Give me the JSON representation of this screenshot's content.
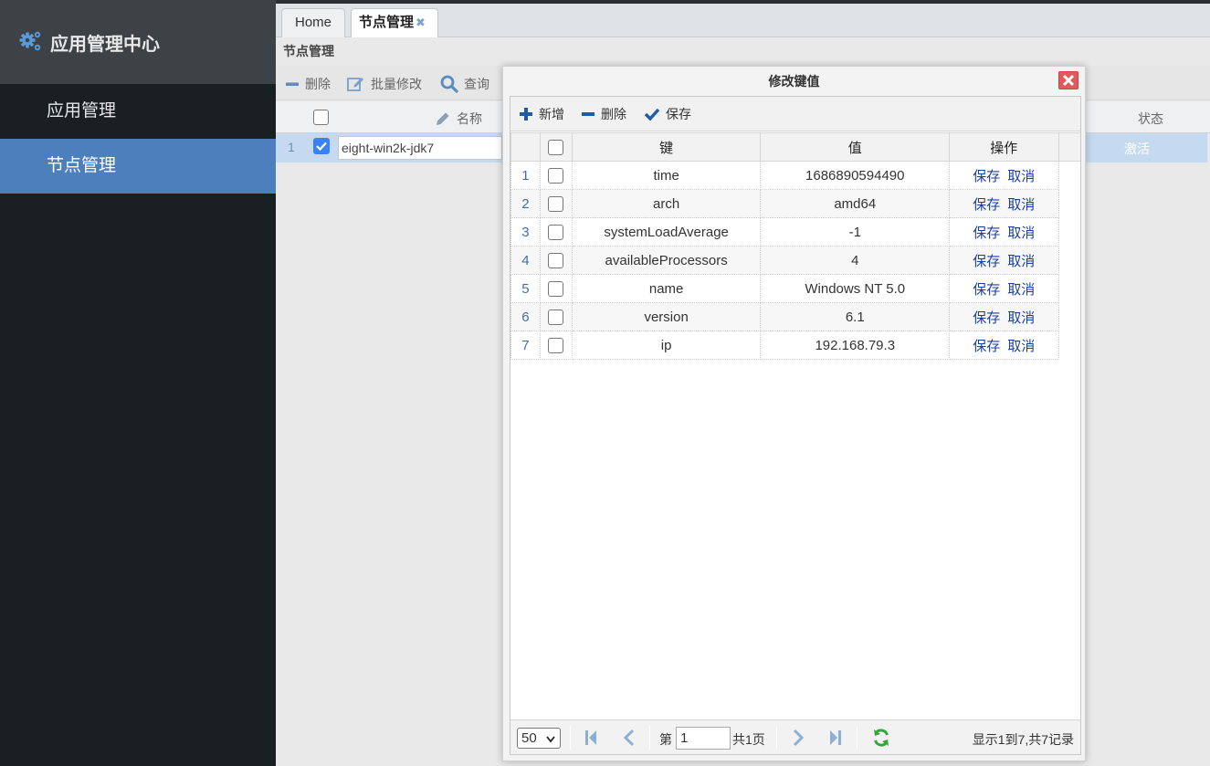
{
  "sidebar": {
    "title": "应用管理中心",
    "items": [
      {
        "label": "应用管理"
      },
      {
        "label": "节点管理"
      }
    ]
  },
  "tabs": [
    {
      "label": "Home"
    },
    {
      "label": "节点管理"
    }
  ],
  "panel": {
    "title": "节点管理",
    "toolbar": {
      "delete": "删除",
      "batch_edit": "批量修改",
      "query": "查询"
    },
    "columns": {
      "name": "名称",
      "status": "状态"
    },
    "row": {
      "num": "1",
      "name": "eight-win2k-jdk7",
      "status": "激活"
    }
  },
  "modal": {
    "title": "修改键值",
    "toolbar": {
      "add": "新增",
      "delete": "删除",
      "save": "保存"
    },
    "columns": {
      "key": "键",
      "value": "值",
      "action": "操作"
    },
    "rows": [
      {
        "num": "1",
        "key": "time",
        "value": "1686890594490"
      },
      {
        "num": "2",
        "key": "arch",
        "value": "amd64"
      },
      {
        "num": "3",
        "key": "systemLoadAverage",
        "value": "-1"
      },
      {
        "num": "4",
        "key": "availableProcessors",
        "value": "4"
      },
      {
        "num": "5",
        "key": "name",
        "value": "Windows NT 5.0"
      },
      {
        "num": "6",
        "key": "version",
        "value": "6.1"
      },
      {
        "num": "7",
        "key": "ip",
        "value": "192.168.79.3"
      }
    ],
    "row_actions": {
      "save": "保存",
      "cancel": "取消"
    },
    "pager": {
      "page_size": "50",
      "page_prefix": "第",
      "page_value": "1",
      "page_total": "共1页",
      "summary": "显示1到7,共7记录"
    }
  },
  "colors": {
    "accent": "#4e7fbd",
    "sidebar_bg": "#1a1f22",
    "link": "#1a3f9e",
    "refresh": "#3aa63a"
  }
}
